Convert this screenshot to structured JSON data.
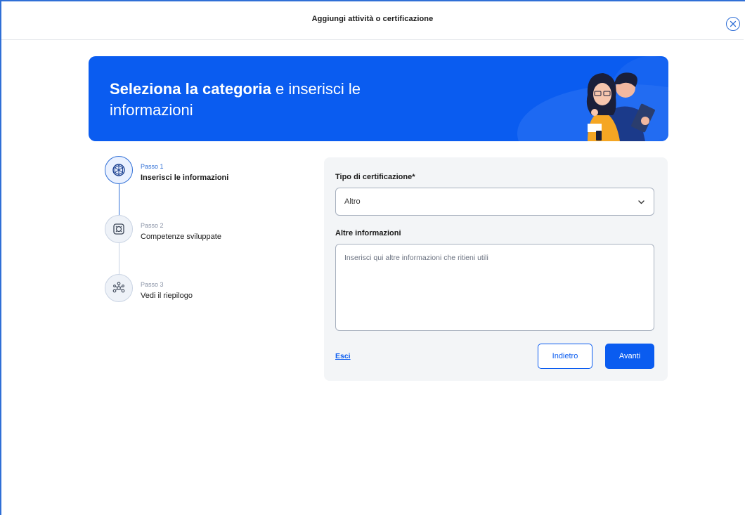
{
  "header": {
    "title": "Aggiungi attività o certificazione",
    "close_icon": "close-icon"
  },
  "hero": {
    "title_bold": "Seleziona la categoria",
    "title_rest": " e inserisci le informazioni",
    "background_color": "#0a5cf0"
  },
  "stepper": {
    "steps": [
      {
        "small": "Passo 1",
        "label": "Inserisci le informazioni",
        "state": "active",
        "icon": "cube-icon"
      },
      {
        "small": "Passo 2",
        "label": "Competenze sviluppate",
        "state": "inactive",
        "icon": "skills-icon"
      },
      {
        "small": "Passo 3",
        "label": "Vedi il riepilogo",
        "state": "inactive",
        "icon": "network-icon"
      }
    ]
  },
  "form": {
    "certification_type_label": "Tipo di certificazione*",
    "certification_type_value": "Altro",
    "other_info_label": "Altre informazioni",
    "other_info_placeholder": "Inserisci qui altre informazioni che ritieni utili",
    "exit_link": "Esci",
    "back_button": "Indietro",
    "next_button": "Avanti"
  },
  "colors": {
    "accent": "#0a5cf0",
    "card_background": "#f3f5f7"
  }
}
